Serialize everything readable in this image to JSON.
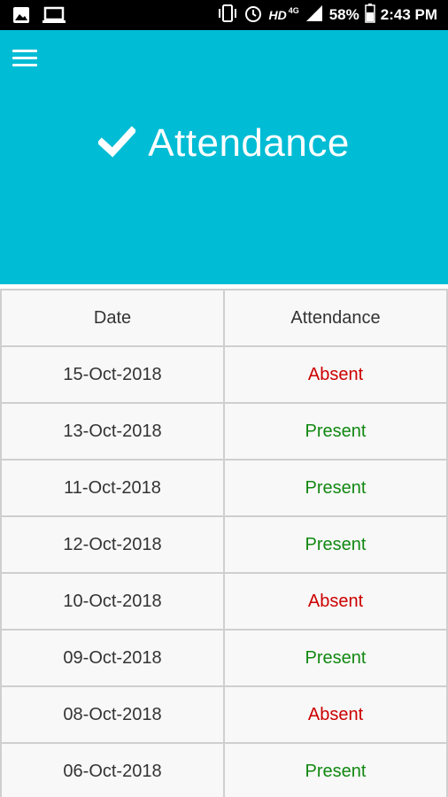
{
  "status_bar": {
    "battery": "58%",
    "time": "2:43 PM",
    "network": "HD",
    "network_type": "4G",
    "icons": [
      "image-icon",
      "laptop-icon",
      "vibrate-icon",
      "alarm-icon",
      "signal-icon",
      "battery-icon"
    ]
  },
  "header": {
    "title": "Attendance",
    "background": "#00bcd4",
    "menu_icon": "hamburger-menu-icon",
    "title_icon": "checkmark-icon"
  },
  "table": {
    "columns": [
      "Date",
      "Attendance"
    ],
    "rows": [
      {
        "date": "15-Oct-2018",
        "status": "Absent"
      },
      {
        "date": "13-Oct-2018",
        "status": "Present"
      },
      {
        "date": "11-Oct-2018",
        "status": "Present"
      },
      {
        "date": "12-Oct-2018",
        "status": "Present"
      },
      {
        "date": "10-Oct-2018",
        "status": "Absent"
      },
      {
        "date": "09-Oct-2018",
        "status": "Present"
      },
      {
        "date": "08-Oct-2018",
        "status": "Absent"
      },
      {
        "date": "06-Oct-2018",
        "status": "Present"
      }
    ],
    "colors": {
      "absent": "#cc0000",
      "present": "#118811"
    }
  }
}
